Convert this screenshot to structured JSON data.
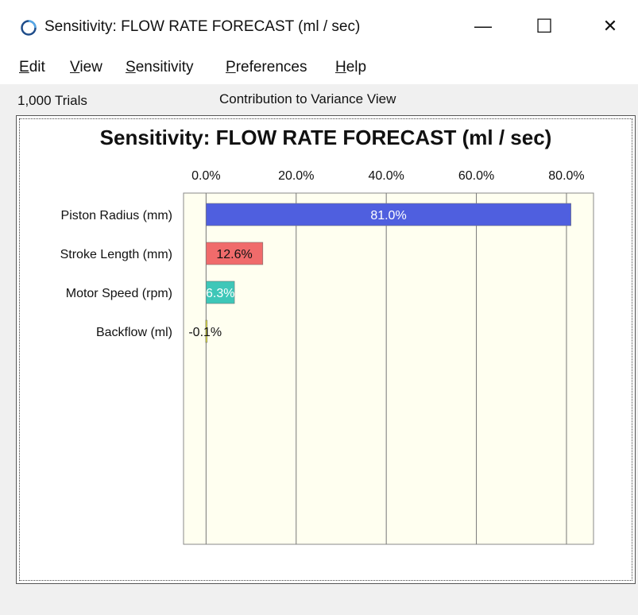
{
  "window": {
    "title": "Sensitivity: FLOW RATE FORECAST (ml / sec)",
    "minimize_glyph": "—",
    "maximize_glyph": "☐",
    "close_glyph": "✕"
  },
  "menu": [
    {
      "label": "Edit",
      "u": "E",
      "rest": "dit"
    },
    {
      "label": "View",
      "u": "V",
      "rest": "iew"
    },
    {
      "label": "Sensitivity",
      "u": "S",
      "rest": "ensitivity"
    },
    {
      "label": "Preferences",
      "u": "P",
      "rest": "references"
    },
    {
      "label": "Help",
      "u": "H",
      "rest": "elp"
    }
  ],
  "status": {
    "trials": "1,000 Trials",
    "view_name": "Contribution to Variance View"
  },
  "chart_data": {
    "type": "bar",
    "orientation": "horizontal",
    "title": "Sensitivity: FLOW RATE FORECAST (ml / sec)",
    "categories": [
      "Piston Radius (mm)",
      "Stroke Length (mm)",
      "Motor Speed (rpm)",
      "Backflow (ml)"
    ],
    "values": [
      81.0,
      12.6,
      6.3,
      -0.1
    ],
    "value_labels": [
      "81.0%",
      "12.6%",
      "6.3%",
      "-0.1%"
    ],
    "colors": [
      "#4f5fdf",
      "#f06b6b",
      "#3ec7b8",
      "#d9d93a"
    ],
    "ticks": [
      0,
      20,
      40,
      60,
      80
    ],
    "tick_labels": [
      "0.0%",
      "20.0%",
      "40.0%",
      "60.0%",
      "80.0%"
    ],
    "xlim": [
      -5,
      86
    ],
    "grid": true,
    "plot_background": "#fffff0"
  }
}
